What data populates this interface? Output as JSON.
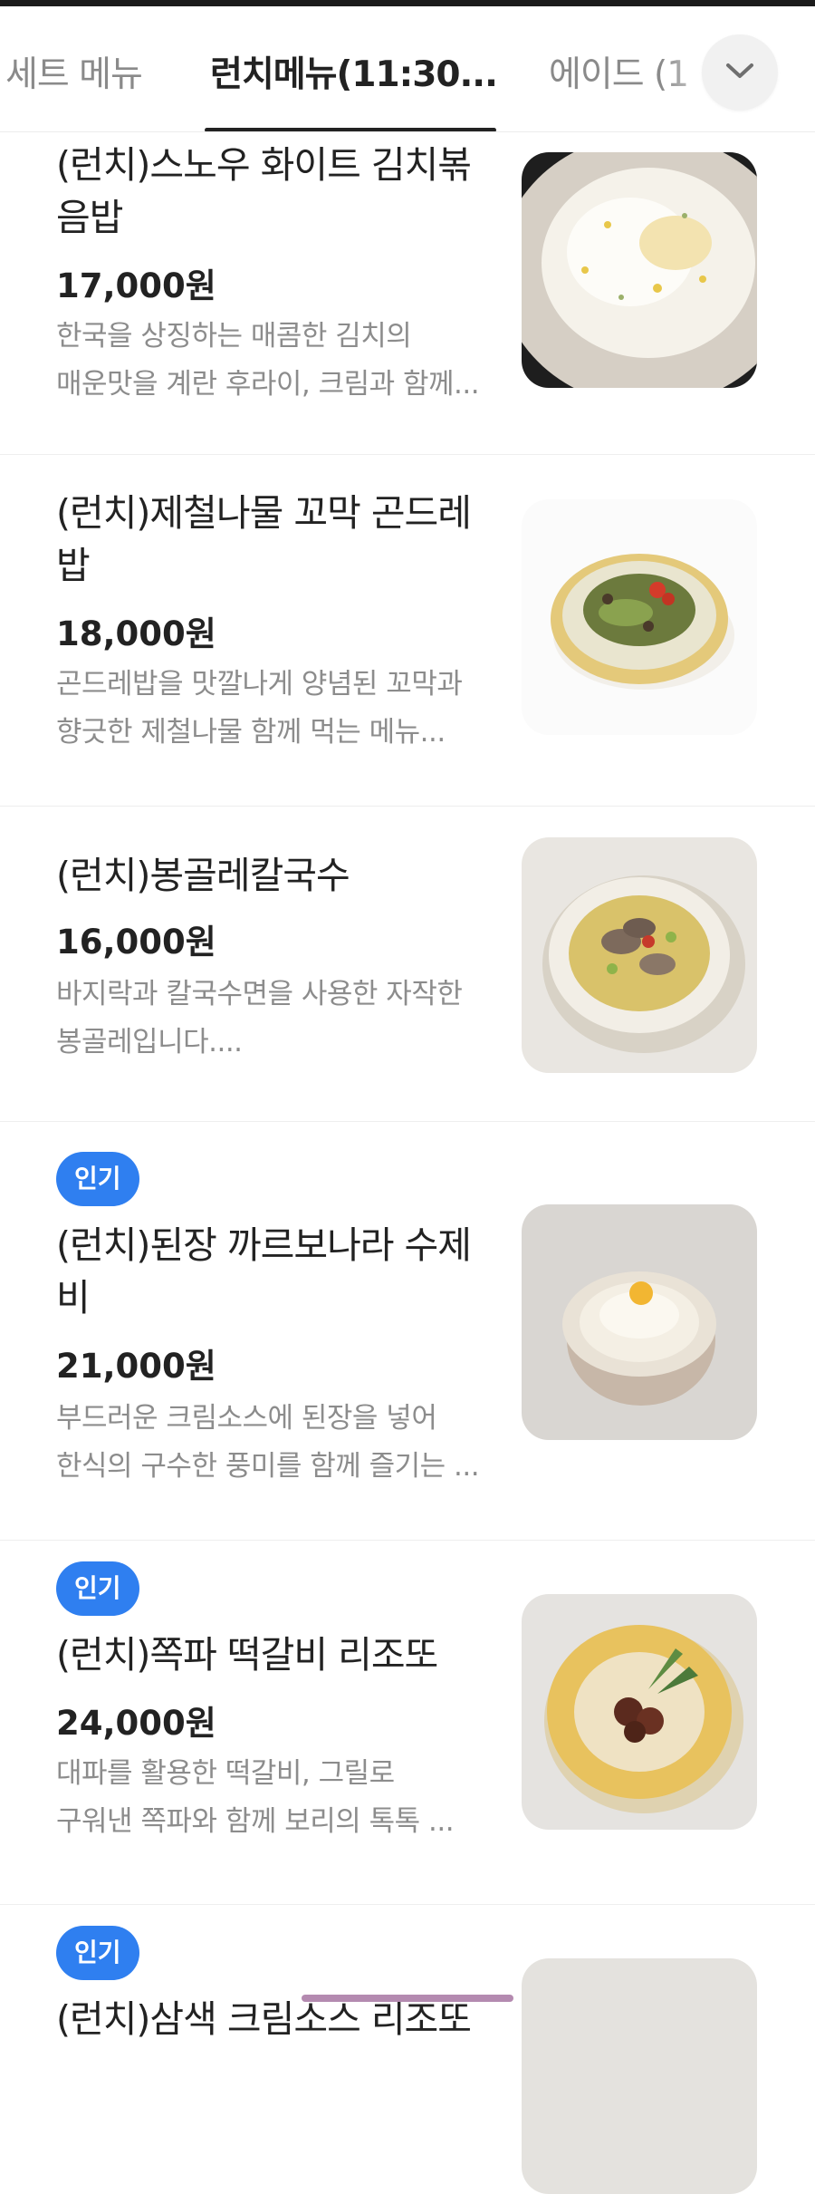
{
  "tabs": [
    {
      "label": "세트 메뉴"
    },
    {
      "label": "런치메뉴(11:30..."
    },
    {
      "label": "에이드 (1"
    }
  ],
  "active_tab": 1,
  "items": [
    {
      "badge": "",
      "name_line1": "(런치)스노우 화이트 김치볶",
      "name_line2": "음밥",
      "price": "17,000원",
      "desc_line1": "한국을 상징하는 매콤한 김치의",
      "desc_line2": "매운맛을 계란 후라이, 크림과 함께...",
      "image": "snow-white-kimchi-fried-rice-image"
    },
    {
      "badge": "",
      "name_line1": "(런치)제철나물 꼬막 곤드레",
      "name_line2": "밥",
      "price": "18,000원",
      "desc_line1": "곤드레밥을 맛깔나게 양념된 꼬막과",
      "desc_line2": "향긋한 제철나물 함께 먹는 메뉴...",
      "image": "cockle-gondre-rice-image"
    },
    {
      "badge": "",
      "name_line1": "(런치)봉골레칼국수",
      "name_line2": "",
      "price": "16,000원",
      "desc_line1": "바지락과 칼국수면을 사용한 자작한",
      "desc_line2": "봉골레입니다....",
      "image": "vongole-kalguksu-image"
    },
    {
      "badge": "인기",
      "name_line1": "(런치)된장 까르보나라 수제",
      "name_line2": "비",
      "price": "21,000원",
      "desc_line1": "부드러운 크림소스에 된장을 넣어",
      "desc_line2": "한식의 구수한 풍미를 함께 즐기는 ...",
      "image": "doenjang-carbonara-sujebi-image"
    },
    {
      "badge": "인기",
      "name_line1": "(런치)쪽파 떡갈비 리조또",
      "name_line2": "",
      "price": "24,000원",
      "desc_line1": "대파를 활용한 떡갈비, 그릴로",
      "desc_line2": "구워낸 쪽파와 함께 보리의 톡톡 ...",
      "image": "scallion-tteokgalbi-risotto-image"
    },
    {
      "badge": "인기",
      "name_line1": "(런치)삼색 크림소스 리조또",
      "name_line2": "",
      "price": "",
      "desc_line1": "",
      "desc_line2": "",
      "image": "partial-menu-image"
    }
  ],
  "icons": {
    "more_tabs": "chevron-down-icon"
  },
  "colors": {
    "badge": "#2f7ff0",
    "scroll_indicator": "#b48ab0"
  }
}
